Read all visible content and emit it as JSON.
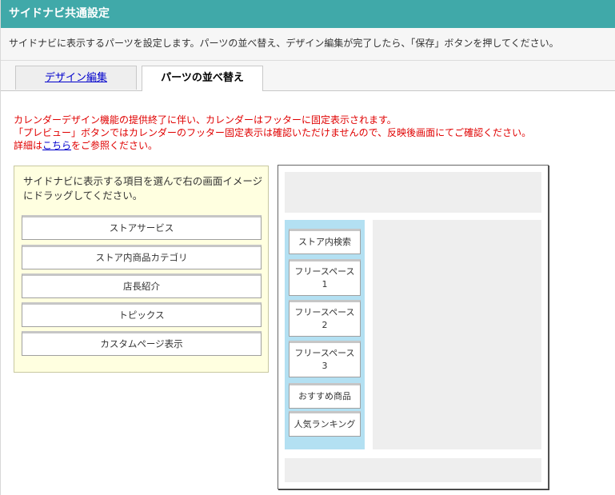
{
  "header": {
    "title": "サイドナビ共通設定",
    "description": "サイドナビに表示するパーツを設定します。パーツの並べ替え、デザイン編集が完了したら、「保存」ボタンを押してください。"
  },
  "tabs": [
    {
      "label": "デザイン編集",
      "active": false
    },
    {
      "label": "パーツの並べ替え",
      "active": true
    }
  ],
  "notice": {
    "line1": "カレンダーデザイン機能の提供終了に伴い、カレンダーはフッターに固定表示されます。",
    "line2": "「プレビュー」ボタンではカレンダーのフッター固定表示は確認いただけませんので、反映後画面にてご確認ください。",
    "line3_prefix": "詳細は",
    "line3_link": "こちら",
    "line3_suffix": "をご参照ください。"
  },
  "palette": {
    "instruction": "サイドナビに表示する項目を選んで右の画面イメージにドラッグしてください。",
    "items": [
      "ストアサービス",
      "ストア内商品カテゴリ",
      "店長紹介",
      "トピックス",
      "カスタムページ表示"
    ]
  },
  "preview": {
    "sidebar_items": [
      "ストア内検索",
      "フリースペース\n1",
      "フリースペース\n2",
      "フリースペース\n3",
      "おすすめ商品",
      "人気ランキング"
    ]
  },
  "colors": {
    "title_bar": "#40a9a9",
    "notice_text": "#e00000",
    "palette_bg": "#ffffe0",
    "sidebar_bg": "#b3e0f2",
    "link": "#0000cc"
  }
}
